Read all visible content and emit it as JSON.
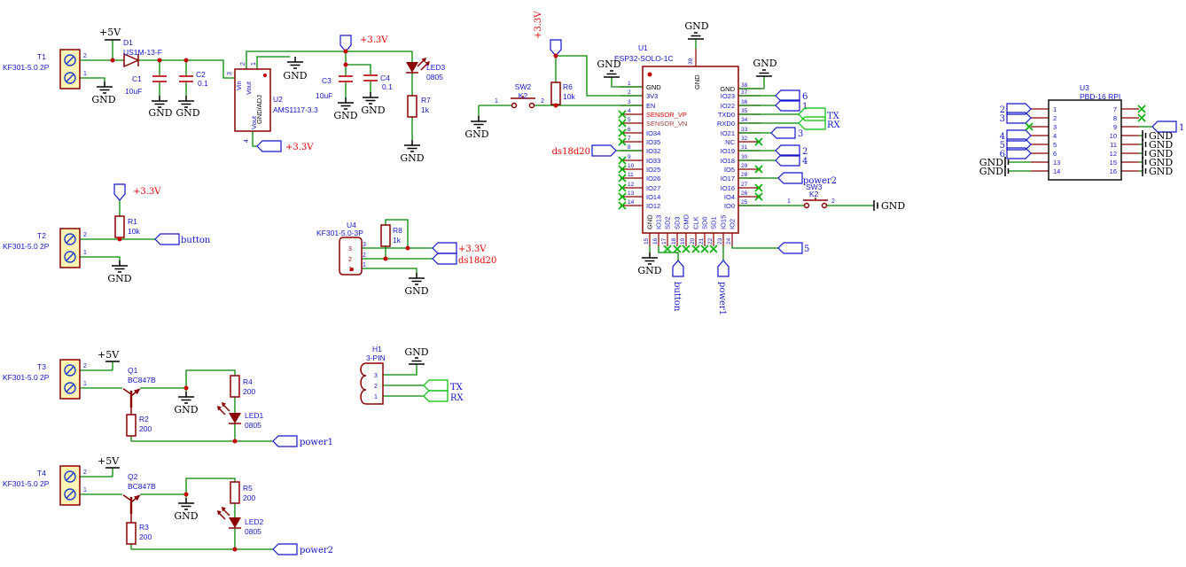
{
  "power_nets": {
    "p5v": "+5V",
    "p33v": "+3.3V",
    "gnd": "GND"
  },
  "nets": {
    "button": "button",
    "power1": "power1",
    "power2": "power2",
    "ds18d20": "ds18d20",
    "tx": "TX",
    "rx": "RX",
    "n1": "1",
    "n2": "2",
    "n3": "3",
    "n4": "4",
    "n5": "5",
    "n6": "6"
  },
  "pin_nums": {
    "p1": "1",
    "p2": "2",
    "p3": "3",
    "p4": "4"
  },
  "components": {
    "t1": {
      "ref": "T1",
      "value": "KF301-5.0 2P"
    },
    "t2": {
      "ref": "T2",
      "value": "KF301-5.0 2P"
    },
    "t3": {
      "ref": "T3",
      "value": "KF301-5.0 2P"
    },
    "t4": {
      "ref": "T4",
      "value": "KF301-5.0 2P"
    },
    "d1": {
      "ref": "D1",
      "value": "US1M-13-F"
    },
    "c1": {
      "ref": "C1",
      "value": "10uF"
    },
    "c2": {
      "ref": "C2",
      "value": "0.1"
    },
    "c3": {
      "ref": "C3",
      "value": "10uF"
    },
    "c4": {
      "ref": "C4",
      "value": "0.1"
    },
    "r1": {
      "ref": "R1",
      "value": "10k"
    },
    "r2": {
      "ref": "R2",
      "value": "200"
    },
    "r3": {
      "ref": "R3",
      "value": "200"
    },
    "r4": {
      "ref": "R4",
      "value": "200"
    },
    "r5": {
      "ref": "R5",
      "value": "200"
    },
    "r6": {
      "ref": "R6",
      "value": "10k"
    },
    "r7": {
      "ref": "R7",
      "value": "1k"
    },
    "r8": {
      "ref": "R8",
      "value": "1k"
    },
    "led1": {
      "ref": "LED1",
      "value": "0805"
    },
    "led2": {
      "ref": "LED2",
      "value": "0805"
    },
    "led3": {
      "ref": "LED3",
      "value": "0805"
    },
    "q1": {
      "ref": "Q1",
      "value": "BC847B"
    },
    "q2": {
      "ref": "Q2",
      "value": "BC847B"
    },
    "sw2": {
      "ref": "SW2",
      "value": "K2"
    },
    "sw3": {
      "ref": "SW3",
      "value": "K2"
    },
    "u2": {
      "ref": "U2",
      "value": "AMS1117-3.3",
      "pin_names": {
        "vin": "Vin",
        "vout": "Vout",
        "gnd_adj": "GND/ADJ",
        "vout2": "Vout"
      }
    },
    "u4": {
      "ref": "U4",
      "value": "KF301-5.0-3P"
    },
    "h1": {
      "ref": "H1",
      "value": "3-PIN"
    },
    "u1": {
      "ref": "U1",
      "value": "ESP32-SOLO-1C",
      "top_pin": {
        "num": "39",
        "name": "GND"
      },
      "left_pins": [
        {
          "num": "1",
          "name": "GND"
        },
        {
          "num": "2",
          "name": "3V3"
        },
        {
          "num": "3",
          "name": "EN"
        },
        {
          "num": "4",
          "name": "SENSOR_VP"
        },
        {
          "num": "5",
          "name": "SENSOR_VN"
        },
        {
          "num": "6",
          "name": "IO34"
        },
        {
          "num": "7",
          "name": "IO35"
        },
        {
          "num": "8",
          "name": "IO32"
        },
        {
          "num": "9",
          "name": "IO33"
        },
        {
          "num": "10",
          "name": "IO25"
        },
        {
          "num": "11",
          "name": "IO26"
        },
        {
          "num": "12",
          "name": "IO27"
        },
        {
          "num": "13",
          "name": "IO14"
        },
        {
          "num": "14",
          "name": "IO12"
        }
      ],
      "right_pins": [
        {
          "num": "38",
          "name": "GND"
        },
        {
          "num": "37",
          "name": "IO23"
        },
        {
          "num": "36",
          "name": "IO22"
        },
        {
          "num": "35",
          "name": "TXD0"
        },
        {
          "num": "34",
          "name": "RXD0"
        },
        {
          "num": "33",
          "name": "IO21"
        },
        {
          "num": "32",
          "name": "NC"
        },
        {
          "num": "31",
          "name": "IO19"
        },
        {
          "num": "30",
          "name": "IO18"
        },
        {
          "num": "29",
          "name": "IO5"
        },
        {
          "num": "28",
          "name": "IO17"
        },
        {
          "num": "27",
          "name": "IO16"
        },
        {
          "num": "26",
          "name": "IO4"
        },
        {
          "num": "25",
          "name": "IO0"
        }
      ],
      "bottom_pins": [
        {
          "num": "15",
          "name": "GND"
        },
        {
          "num": "16",
          "name": "IO13"
        },
        {
          "num": "17",
          "name": "SD2"
        },
        {
          "num": "18",
          "name": "SD3"
        },
        {
          "num": "19",
          "name": "CMD"
        },
        {
          "num": "20",
          "name": "CLK"
        },
        {
          "num": "21",
          "name": "SD0"
        },
        {
          "num": "22",
          "name": "SD1"
        },
        {
          "num": "23",
          "name": "IO15"
        },
        {
          "num": "24",
          "name": "IO2"
        }
      ]
    },
    "u3": {
      "ref": "U3",
      "value": "PBD-16 RPI",
      "left_pins": [
        {
          "num": "1",
          "label": "2"
        },
        {
          "num": "2",
          "label": "3"
        },
        {
          "num": "3",
          "label": ""
        },
        {
          "num": "4",
          "label": "4"
        },
        {
          "num": "5",
          "label": "5"
        },
        {
          "num": "6",
          "label": "6"
        },
        {
          "num": "13",
          "label": "GND"
        },
        {
          "num": "14",
          "label": "GND"
        }
      ],
      "right_pins": [
        {
          "num": "7",
          "label": ""
        },
        {
          "num": "8",
          "label": ""
        },
        {
          "num": "9",
          "label": "1"
        },
        {
          "num": "10",
          "label": "GND"
        },
        {
          "num": "11",
          "label": "GND"
        },
        {
          "num": "12",
          "label": "GND"
        },
        {
          "num": "15",
          "label": "GND"
        },
        {
          "num": "16",
          "label": "GND"
        }
      ]
    }
  },
  "colors": {
    "wire": "#008800",
    "outline": "#8B0000",
    "label_blue": "#1414CC",
    "net_red": "#E80000",
    "gnd_black": "#000000",
    "terminal_fill": "#FCF3B4",
    "no_connect": "#00B400",
    "junction": "#C80000"
  }
}
